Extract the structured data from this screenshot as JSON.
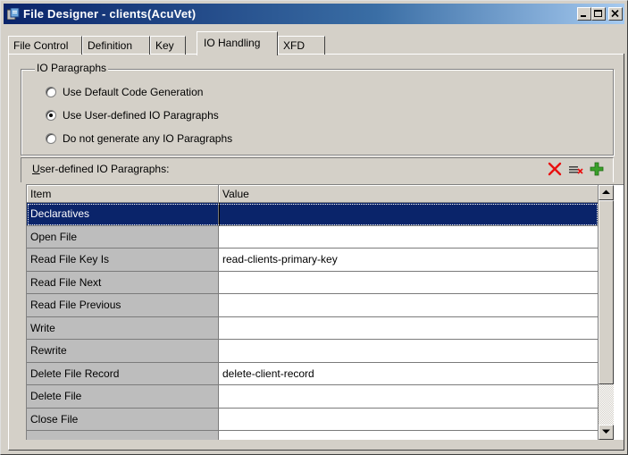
{
  "window": {
    "title": "File Designer - clients(AcuVet)"
  },
  "tabs": [
    {
      "label": "File Control",
      "active": false
    },
    {
      "label": "Definition",
      "active": false
    },
    {
      "label": "Key",
      "active": false
    },
    {
      "label": "IO Handling",
      "active": true
    },
    {
      "label": "XFD",
      "active": false
    }
  ],
  "io_group": {
    "legend": "IO Paragraphs",
    "options": [
      {
        "label": "Use Default Code Generation",
        "selected": false
      },
      {
        "label": "Use User-defined IO Paragraphs",
        "selected": true
      },
      {
        "label": "Do not generate any IO Paragraphs",
        "selected": false
      }
    ]
  },
  "user_defined": {
    "label_accel": "U",
    "label_rest": "ser-defined IO Paragraphs:",
    "tools": [
      "delete-icon",
      "clear-list-icon",
      "add-icon"
    ]
  },
  "grid": {
    "columns": [
      "Item",
      "Value"
    ],
    "rows": [
      {
        "item": "Declaratives",
        "value": ""
      },
      {
        "item": "Open File",
        "value": ""
      },
      {
        "item": "Read File Key Is",
        "value": "read-clients-primary-key"
      },
      {
        "item": "Read File Next",
        "value": ""
      },
      {
        "item": "Read File Previous",
        "value": ""
      },
      {
        "item": "Write",
        "value": ""
      },
      {
        "item": "Rewrite",
        "value": ""
      },
      {
        "item": "Delete File Record",
        "value": "delete-client-record"
      },
      {
        "item": "Delete File",
        "value": ""
      },
      {
        "item": "Close File",
        "value": ""
      },
      {
        "item": "",
        "value": ""
      }
    ],
    "selected_row": 0
  },
  "colors": {
    "selection": "#0a246a",
    "delete": "#e81010",
    "add": "#3aa02a"
  }
}
